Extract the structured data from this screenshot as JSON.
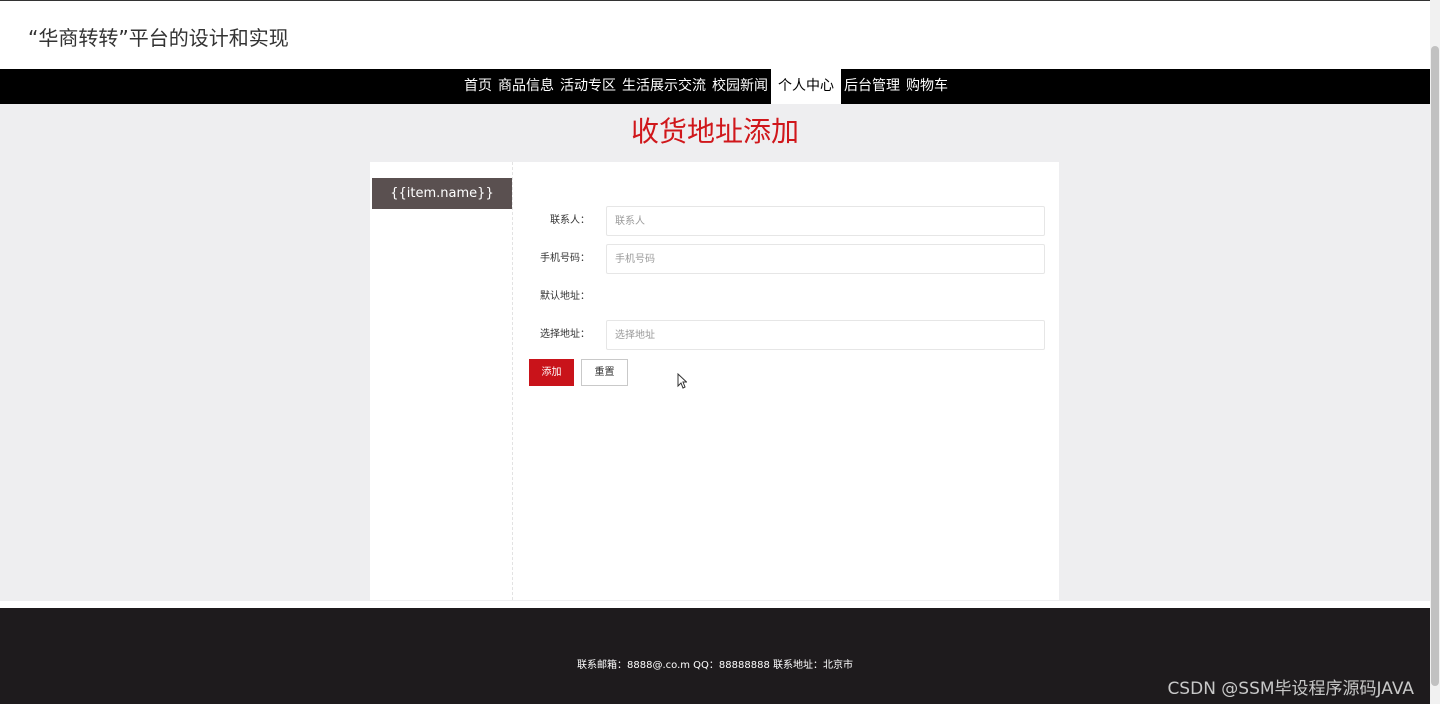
{
  "header": {
    "title": "“华商转转”平台的设计和实现"
  },
  "nav": {
    "items": [
      "首页",
      "商品信息",
      "活动专区",
      "生活展示交流",
      "校园新闻",
      "个人中心",
      "后台管理",
      "购物车"
    ],
    "active": "个人中心"
  },
  "page": {
    "heading": "收货地址添加"
  },
  "side_menu": {
    "items": [
      {
        "label": "{{item.name}}"
      }
    ]
  },
  "form": {
    "fields": [
      {
        "label": "联系人：",
        "placeholder": "联系人",
        "value": ""
      },
      {
        "label": "手机号码：",
        "placeholder": "手机号码",
        "value": ""
      },
      {
        "label": "默认地址："
      },
      {
        "label": "选择地址：",
        "placeholder": "选择地址",
        "value": ""
      }
    ],
    "submit_label": "添加",
    "reset_label": "重置"
  },
  "footer": {
    "text": "联系邮箱：8888@.co.m QQ：88888888 联系地址：北京市"
  },
  "watermark": "CSDN @SSM毕设程序源码JAVA",
  "colors": {
    "accent": "#c9131a",
    "heading": "#d0171b",
    "nav_bg": "#000000",
    "footer_bg": "#1e1b1d",
    "side_item_bg": "#5a5050"
  }
}
